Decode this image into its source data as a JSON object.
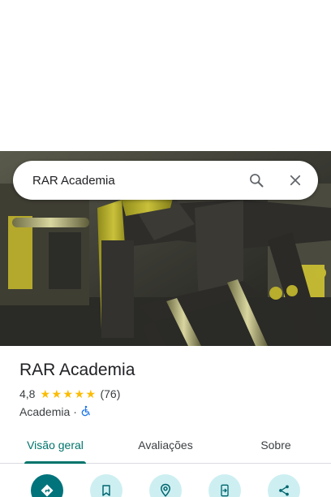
{
  "search": {
    "query": "RAR Academia",
    "search_icon": "search-icon",
    "close_icon": "close-icon"
  },
  "place": {
    "name": "RAR Academia",
    "rating": "4,8",
    "rating_value": 4.8,
    "stars": 5,
    "review_count": "(76)",
    "category": "Academia",
    "separator": "·",
    "accessibility_icon": "wheelchair-icon"
  },
  "tabs": [
    {
      "label": "Visão geral",
      "active": true
    },
    {
      "label": "Avaliações",
      "active": false
    },
    {
      "label": "Sobre",
      "active": false
    }
  ],
  "actions": [
    {
      "icon": "directions-icon"
    },
    {
      "icon": "bookmark-icon"
    },
    {
      "icon": "nearby-icon"
    },
    {
      "icon": "send-to-phone-icon"
    },
    {
      "icon": "share-icon"
    }
  ],
  "colors": {
    "accent": "#00736b",
    "star": "#fbbc04",
    "action_bg": "#cdeff2"
  }
}
